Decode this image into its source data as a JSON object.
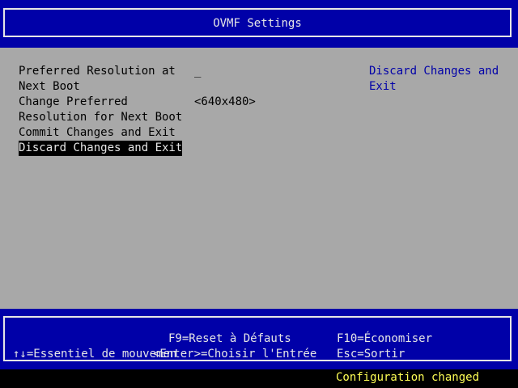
{
  "title": "OVMF Settings",
  "menu": {
    "options": [
      {
        "lines": [
          "Preferred Resolution at",
          "Next Boot"
        ],
        "value": "_"
      },
      {
        "lines": [
          "Change Preferred",
          "Resolution for Next Boot"
        ],
        "value": "<640x480>"
      },
      {
        "lines": [
          "Commit Changes and Exit"
        ]
      },
      {
        "lines": [
          "Discard Changes and Exit"
        ],
        "selected": true
      }
    ]
  },
  "help_text": [
    "Discard Changes and",
    "Exit"
  ],
  "footer": {
    "f9": "F9=Reset à Défauts",
    "f10": "F10=Économiser",
    "navigate": "↑↓=Essentiel de mouvemen",
    "enter": "<Enter>=Choisir l'Entrée",
    "esc": "Esc=Sortir"
  },
  "status": "Configuration changed",
  "colors": {
    "frame_blue": "#0000a8",
    "panel_gray": "#a8a8a8",
    "help_blue": "#0000a8",
    "status_yellow": "#ffff55",
    "highlight_black": "#000000"
  }
}
